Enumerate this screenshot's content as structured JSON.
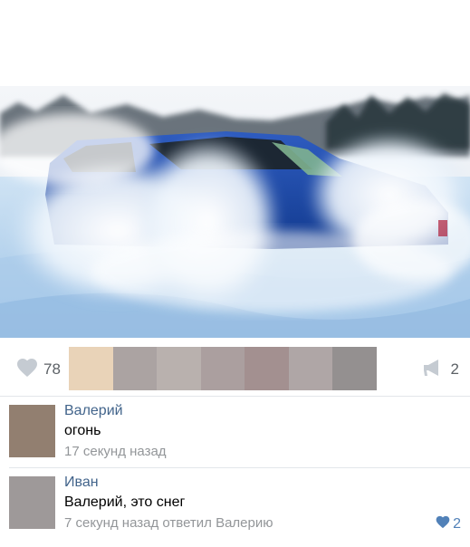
{
  "post": {
    "image_icon": "photo-car-drifting-in-snow",
    "likes_count": "78",
    "shares_count": "2",
    "palette": [
      "#e9d3b8",
      "#aba3a2",
      "#b9b1ae",
      "#ab9f9f",
      "#a39090",
      "#afa6a6",
      "#949090"
    ]
  },
  "comments": [
    {
      "author": "Валерий",
      "text": "огонь",
      "meta": "17 секунд назад",
      "avatar_color": "#927f70"
    },
    {
      "author": "Иван",
      "text": "Валерий, это снег",
      "meta": "7 секунд назад ответил Валерию",
      "likes": "2",
      "avatar_color": "#9e9999"
    }
  ],
  "colors": {
    "link": "#42648b",
    "accent": "#5181b8",
    "muted": "#939699",
    "icon": "#c5cbd2"
  },
  "icons": [
    "heart-icon",
    "megaphone-icon",
    "heart-filled-icon"
  ]
}
